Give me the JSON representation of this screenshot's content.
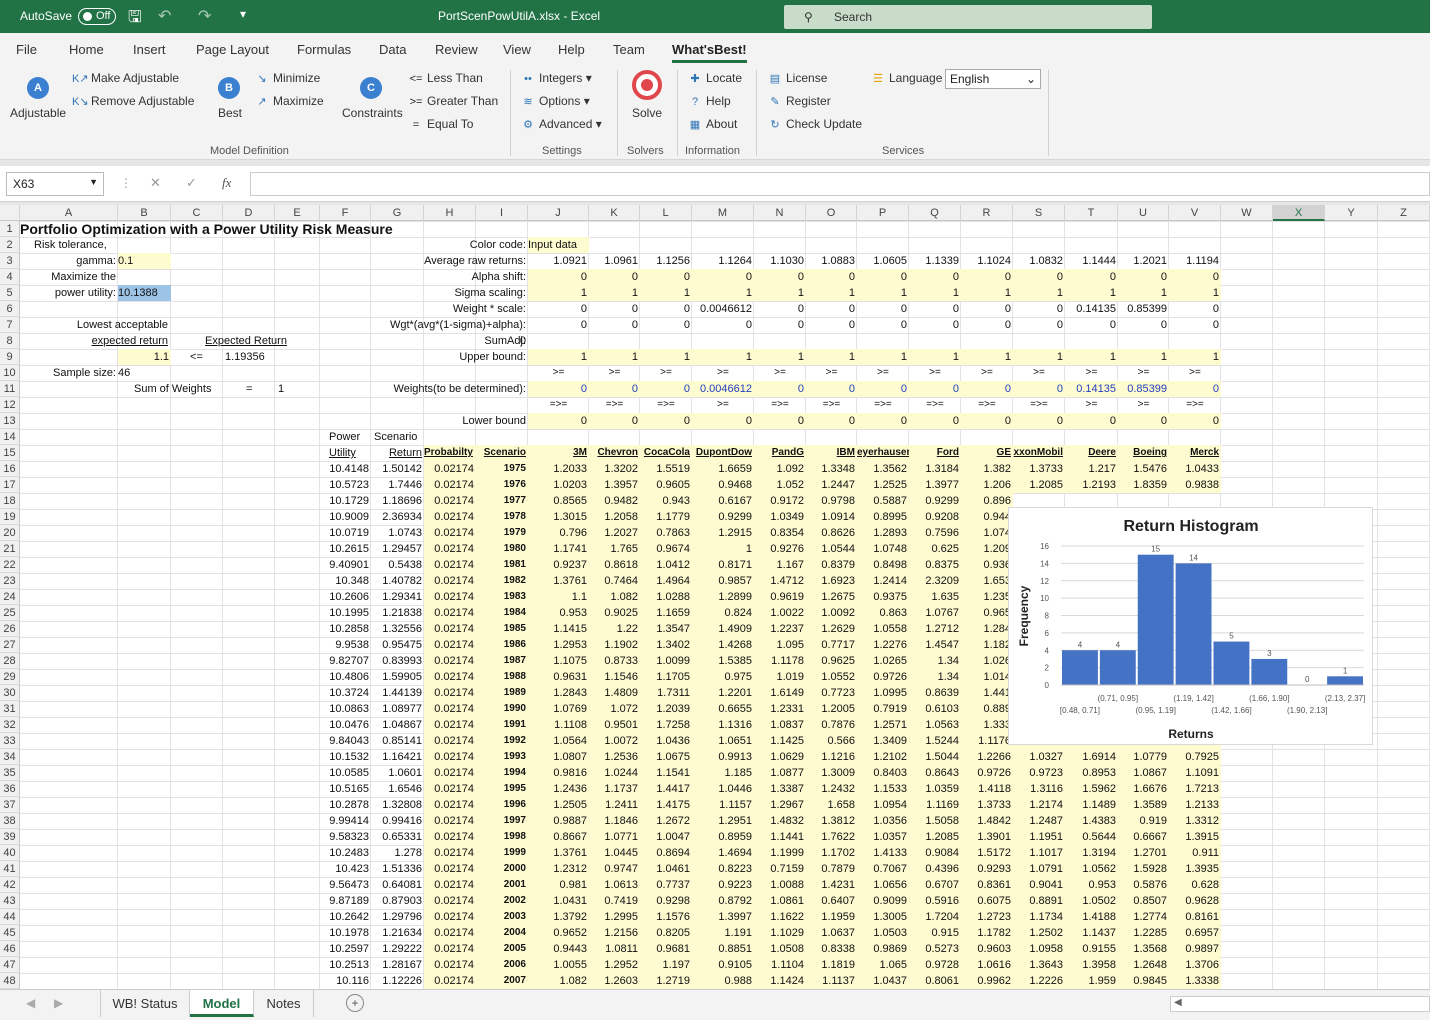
{
  "titlebar": {
    "autosave": "AutoSave",
    "toggle": "Off",
    "filename": "PortScenPowUtilA.xlsx  -  Excel",
    "search": "Search"
  },
  "tabs": [
    "File",
    "Home",
    "Insert",
    "Page Layout",
    "Formulas",
    "Data",
    "Review",
    "View",
    "Help",
    "Team",
    "What'sBest!"
  ],
  "ribbon": {
    "adjustable": "Adjustable",
    "make_adjustable": "Make Adjustable",
    "remove_adjustable": "Remove Adjustable",
    "best": "Best",
    "minimize": "Minimize",
    "maximize": "Maximize",
    "constraints": "Constraints",
    "less_than": "Less Than",
    "greater_than": "Greater Than",
    "equal_to": "Equal To",
    "integers": "Integers",
    "options": "Options",
    "advanced": "Advanced",
    "solve": "Solve",
    "locate": "Locate",
    "help": "Help",
    "about": "About",
    "license": "License",
    "register": "Register",
    "check_update": "Check Update",
    "language": "Language",
    "language_value": "English",
    "groups": {
      "model_definition": "Model Definition",
      "settings": "Settings",
      "solvers": "Solvers",
      "information": "Information",
      "services": "Services"
    }
  },
  "formula_bar": {
    "name_box": "X63",
    "cancel": "✕",
    "enter": "✓",
    "fx": "fx",
    "value": ""
  },
  "columns": [
    "A",
    "B",
    "C",
    "D",
    "E",
    "F",
    "G",
    "H",
    "I",
    "J",
    "K",
    "L",
    "M",
    "N",
    "O",
    "P",
    "Q",
    "R",
    "S",
    "T",
    "U",
    "V",
    "W",
    "X",
    "Y",
    "Z"
  ],
  "rows": [
    1,
    2,
    3,
    4,
    5,
    6,
    7,
    8,
    9,
    10,
    11,
    12,
    13,
    14,
    15,
    16,
    17,
    18,
    19,
    20,
    21,
    22,
    23,
    24,
    25,
    26,
    27,
    28,
    29,
    30,
    31,
    32,
    33,
    34,
    35,
    36,
    37,
    38,
    39,
    40,
    41,
    42,
    43,
    44,
    45,
    46,
    47,
    48
  ],
  "cells": {
    "title": "Portfolio Optimization with a Power Utility Risk Measure",
    "risk_tol": "Risk tolerance,",
    "gamma_lbl": "gamma:",
    "gamma": "0.1",
    "max_the": "Maximize the",
    "power_util_lbl": "power utility:",
    "power_util": "10.1388",
    "lowest": "Lowest acceptable",
    "exp_ret_lbl": "expected return",
    "exp_ret_hdr": "Expected Return",
    "min_ret": "1.1",
    "le": "<=",
    "exp_ret": "1.19356",
    "sample_lbl": "Sample size:",
    "sample": "46",
    "sum_w_lbl": "Sum of Weights",
    "eq": "=",
    "sum_w": "1",
    "color_code": "Color code:",
    "input_data": "Input data",
    "avg_raw": "Average raw returns:",
    "alpha": "Alpha shift:",
    "sigma": "Sigma scaling:",
    "wscale": "Weight * scale:",
    "wgt_expr": "Wgt*(avg*(1-sigma)+alpha):",
    "sumadj": "SumAdj:",
    "sumadj_v": "0",
    "upper": "Upper bound:",
    "weights_lbl": "Weights(to be determined):",
    "lower": "Lower bound",
    "power": "Power",
    "scenario": "Scenario",
    "utility": "Utility",
    "return": "Return",
    "probability": "Probabilty",
    "scen_hdr": "Scenario"
  },
  "assets": [
    "3M",
    "Chevron",
    "CocaCola",
    "DupontDow",
    "PandG",
    "IBM",
    "eyerhauser",
    "Ford",
    "GE",
    "xxonMobil",
    "Deere",
    "Boeing",
    "Merck"
  ],
  "avg_returns": [
    "1.0921",
    "1.0961",
    "1.1256",
    "1.1264",
    "1.1030",
    "1.0883",
    "1.0605",
    "1.1339",
    "1.1024",
    "1.0832",
    "1.1444",
    "1.2021",
    "1.1194"
  ],
  "alpha_row": [
    "0",
    "0",
    "0",
    "0",
    "0",
    "0",
    "0",
    "0",
    "0",
    "0",
    "0",
    "0",
    "0"
  ],
  "sigma_row": [
    "1",
    "1",
    "1",
    "1",
    "1",
    "1",
    "1",
    "1",
    "1",
    "1",
    "1",
    "1",
    "1"
  ],
  "wscale_row": [
    "0",
    "0",
    "0",
    "0.0046612",
    "0",
    "0",
    "0",
    "0",
    "0",
    "0",
    "0.14135",
    "0.85399",
    "0"
  ],
  "wgt_row": [
    "0",
    "0",
    "0",
    "0",
    "0",
    "0",
    "0",
    "0",
    "0",
    "0",
    "0",
    "0",
    "0"
  ],
  "upper_row": [
    "1",
    "1",
    "1",
    "1",
    "1",
    "1",
    "1",
    "1",
    "1",
    "1",
    "1",
    "1",
    "1"
  ],
  "ge_row": [
    ">=",
    ">=",
    ">=",
    ">=",
    ">=",
    ">=",
    ">=",
    ">=",
    ">=",
    ">=",
    ">=",
    ">=",
    ">="
  ],
  "weights_row": [
    "0",
    "0",
    "0",
    "0.0046612",
    "0",
    "0",
    "0",
    "0",
    "0",
    "0",
    "0.14135",
    "0.85399",
    "0"
  ],
  "geq_row": [
    "=>=",
    "=>=",
    "=>=",
    ">=",
    "=>=",
    "=>=",
    "=>=",
    "=>=",
    "=>=",
    "=>=",
    ">=",
    ">=",
    "=>="
  ],
  "lower_row": [
    "0",
    "0",
    "0",
    "0",
    "0",
    "0",
    "0",
    "0",
    "0",
    "0",
    "0",
    "0",
    "0"
  ],
  "data_rows": [
    [
      "10.4148",
      "1.50142",
      "0.02174",
      "1975",
      "1.2033",
      "1.3202",
      "1.5519",
      "1.6659",
      "1.092",
      "1.3348",
      "1.3562",
      "1.3184",
      "1.382",
      "1.3733",
      "1.217",
      "1.5476",
      "1.0433"
    ],
    [
      "10.5723",
      "1.7446",
      "0.02174",
      "1976",
      "1.0203",
      "1.3957",
      "0.9605",
      "0.9468",
      "1.052",
      "1.2447",
      "1.2525",
      "1.3977",
      "1.206",
      "1.2085",
      "1.2193",
      "1.8359",
      "0.9838"
    ],
    [
      "10.1729",
      "1.18696",
      "0.02174",
      "1977",
      "0.8565",
      "0.9482",
      "0.943",
      "0.6167",
      "0.9172",
      "0.9798",
      "0.5887",
      "0.9299",
      "0.896",
      "",
      "",
      "",
      ""
    ],
    [
      "10.9009",
      "2.36934",
      "0.02174",
      "1978",
      "1.3015",
      "1.2058",
      "1.1779",
      "0.9299",
      "1.0349",
      "1.0914",
      "0.8995",
      "0.9208",
      "0.944",
      "",
      "",
      "",
      ""
    ],
    [
      "10.0719",
      "1.0743",
      "0.02174",
      "1979",
      "0.796",
      "1.2027",
      "0.7863",
      "1.2915",
      "0.8354",
      "0.8626",
      "1.2893",
      "0.7596",
      "1.074",
      "",
      "",
      "",
      ""
    ],
    [
      "10.2615",
      "1.29457",
      "0.02174",
      "1980",
      "1.1741",
      "1.765",
      "0.9674",
      "1",
      "0.9276",
      "1.0544",
      "1.0748",
      "0.625",
      "1.209",
      "",
      "",
      "",
      ""
    ],
    [
      "9.40901",
      "0.5438",
      "0.02174",
      "1981",
      "0.9237",
      "0.8618",
      "1.0412",
      "0.8171",
      "1.167",
      "0.8379",
      "0.8498",
      "0.8375",
      "0.936",
      "",
      "",
      "",
      ""
    ],
    [
      "10.348",
      "1.40782",
      "0.02174",
      "1982",
      "1.3761",
      "0.7464",
      "1.4964",
      "0.9857",
      "1.4712",
      "1.6923",
      "1.2414",
      "2.3209",
      "1.653",
      "",
      "",
      "",
      ""
    ],
    [
      "10.2606",
      "1.29341",
      "0.02174",
      "1983",
      "1.1",
      "1.082",
      "1.0288",
      "1.2899",
      "0.9619",
      "1.2675",
      "0.9375",
      "1.635",
      "1.235",
      "",
      "",
      "",
      ""
    ],
    [
      "10.1995",
      "1.21838",
      "0.02174",
      "1984",
      "0.953",
      "0.9025",
      "1.1659",
      "0.824",
      "1.0022",
      "1.0092",
      "0.863",
      "1.0767",
      "0.965",
      "",
      "",
      "",
      ""
    ],
    [
      "10.2858",
      "1.32556",
      "0.02174",
      "1985",
      "1.1415",
      "1.22",
      "1.3547",
      "1.4909",
      "1.2237",
      "1.2629",
      "1.0558",
      "1.2712",
      "1.284",
      "",
      "",
      "",
      ""
    ],
    [
      "9.9538",
      "0.95475",
      "0.02174",
      "1986",
      "1.2953",
      "1.1902",
      "1.3402",
      "1.4268",
      "1.095",
      "0.7717",
      "1.2276",
      "1.4547",
      "1.182",
      "",
      "",
      "",
      ""
    ],
    [
      "9.82707",
      "0.83993",
      "0.02174",
      "1987",
      "1.1075",
      "0.8733",
      "1.0099",
      "1.5385",
      "1.1178",
      "0.9625",
      "1.0265",
      "1.34",
      "1.026",
      "",
      "",
      "",
      ""
    ],
    [
      "10.4806",
      "1.59905",
      "0.02174",
      "1988",
      "0.9631",
      "1.1546",
      "1.1705",
      "0.975",
      "1.019",
      "1.0552",
      "0.9726",
      "1.34",
      "1.014",
      "",
      "",
      "",
      ""
    ],
    [
      "10.3724",
      "1.44139",
      "0.02174",
      "1989",
      "1.2843",
      "1.4809",
      "1.7311",
      "1.2201",
      "1.6149",
      "0.7723",
      "1.0995",
      "0.8639",
      "1.441",
      "",
      "",
      "",
      ""
    ],
    [
      "10.0863",
      "1.08977",
      "0.02174",
      "1990",
      "1.0769",
      "1.072",
      "1.2039",
      "0.6655",
      "1.2331",
      "1.2005",
      "0.7919",
      "0.6103",
      "0.889",
      "",
      "",
      "",
      ""
    ],
    [
      "10.0476",
      "1.04867",
      "0.02174",
      "1991",
      "1.1108",
      "0.9501",
      "1.7258",
      "1.1316",
      "1.0837",
      "0.7876",
      "1.2571",
      "1.0563",
      "1.333",
      "",
      "",
      "",
      ""
    ],
    [
      "9.84043",
      "0.85141",
      "0.02174",
      "1992",
      "1.0564",
      "1.0072",
      "1.0436",
      "1.0651",
      "1.1425",
      "0.566",
      "1.3409",
      "1.5244",
      "1.1176",
      "1.0041",
      "0.9115",
      "0.8403",
      "0.7815"
    ],
    [
      "10.1532",
      "1.16421",
      "0.02174",
      "1993",
      "1.0807",
      "1.2536",
      "1.0675",
      "0.9913",
      "1.0629",
      "1.1216",
      "1.2102",
      "1.5044",
      "1.2266",
      "1.0327",
      "1.6914",
      "1.0779",
      "0.7925"
    ],
    [
      "10.0585",
      "1.0601",
      "0.02174",
      "1994",
      "0.9816",
      "1.0244",
      "1.1541",
      "1.185",
      "1.0877",
      "1.3009",
      "0.8403",
      "0.8643",
      "0.9726",
      "0.9723",
      "0.8953",
      "1.0867",
      "1.1091"
    ],
    [
      "10.5165",
      "1.6546",
      "0.02174",
      "1995",
      "1.2436",
      "1.1737",
      "1.4417",
      "1.0446",
      "1.3387",
      "1.2432",
      "1.1533",
      "1.0359",
      "1.4118",
      "1.3116",
      "1.5962",
      "1.6676",
      "1.7213"
    ],
    [
      "10.2878",
      "1.32808",
      "0.02174",
      "1996",
      "1.2505",
      "1.2411",
      "1.4175",
      "1.1157",
      "1.2967",
      "1.658",
      "1.0954",
      "1.1169",
      "1.3733",
      "1.2174",
      "1.1489",
      "1.3589",
      "1.2133"
    ],
    [
      "9.99414",
      "0.99416",
      "0.02174",
      "1997",
      "0.9887",
      "1.1846",
      "1.2672",
      "1.2951",
      "1.4832",
      "1.3812",
      "1.0356",
      "1.5058",
      "1.4842",
      "1.2487",
      "1.4383",
      "0.919",
      "1.3312"
    ],
    [
      "9.58323",
      "0.65331",
      "0.02174",
      "1998",
      "0.8667",
      "1.0771",
      "1.0047",
      "0.8959",
      "1.1441",
      "1.7622",
      "1.0357",
      "1.2085",
      "1.3901",
      "1.1951",
      "0.5644",
      "0.6667",
      "1.3915"
    ],
    [
      "10.2483",
      "1.278",
      "0.02174",
      "1999",
      "1.3761",
      "1.0445",
      "0.8694",
      "1.4694",
      "1.1999",
      "1.1702",
      "1.4133",
      "0.9084",
      "1.5172",
      "1.1017",
      "1.3194",
      "1.2701",
      "0.911"
    ],
    [
      "10.423",
      "1.51336",
      "0.02174",
      "2000",
      "1.2312",
      "0.9747",
      "1.0461",
      "0.8223",
      "0.7159",
      "0.7879",
      "0.7067",
      "0.4396",
      "0.9293",
      "1.0791",
      "1.0562",
      "1.5928",
      "1.3935"
    ],
    [
      "9.56473",
      "0.64081",
      "0.02174",
      "2001",
      "0.981",
      "1.0613",
      "0.7737",
      "0.9223",
      "1.0088",
      "1.4231",
      "1.0656",
      "0.6707",
      "0.8361",
      "0.9041",
      "0.953",
      "0.5876",
      "0.628"
    ],
    [
      "9.87189",
      "0.87903",
      "0.02174",
      "2002",
      "1.0431",
      "0.7419",
      "0.9298",
      "0.8792",
      "1.0861",
      "0.6407",
      "0.9099",
      "0.5916",
      "0.6075",
      "0.8891",
      "1.0502",
      "0.8507",
      "0.9628"
    ],
    [
      "10.2642",
      "1.29796",
      "0.02174",
      "2003",
      "1.3792",
      "1.2995",
      "1.1576",
      "1.3997",
      "1.1622",
      "1.1959",
      "1.3005",
      "1.7204",
      "1.2723",
      "1.1734",
      "1.4188",
      "1.2774",
      "0.8161"
    ],
    [
      "10.1978",
      "1.21634",
      "0.02174",
      "2004",
      "0.9652",
      "1.2156",
      "0.8205",
      "1.191",
      "1.1029",
      "1.0637",
      "1.0503",
      "0.915",
      "1.1782",
      "1.2502",
      "1.1437",
      "1.2285",
      "0.6957"
    ],
    [
      "10.2597",
      "1.29222",
      "0.02174",
      "2005",
      "0.9443",
      "1.0811",
      "0.9681",
      "0.8851",
      "1.0508",
      "0.8338",
      "0.9869",
      "0.5273",
      "0.9603",
      "1.0958",
      "0.9155",
      "1.3568",
      "0.9897"
    ],
    [
      "10.2513",
      "1.28167",
      "0.02174",
      "2006",
      "1.0055",
      "1.2952",
      "1.197",
      "0.9105",
      "1.1104",
      "1.1819",
      "1.065",
      "0.9728",
      "1.0616",
      "1.3643",
      "1.3958",
      "1.2648",
      "1.3706"
    ],
    [
      "10.116",
      "1.12226",
      "0.02174",
      "2007",
      "1.082",
      "1.2603",
      "1.2719",
      "0.988",
      "1.1424",
      "1.1137",
      "1.0437",
      "0.8061",
      "0.9962",
      "1.2226",
      "1.959",
      "0.9845",
      "1.3338"
    ]
  ],
  "chart_data": {
    "type": "bar",
    "title": "Return Histogram",
    "xlabel": "Returns",
    "ylabel": "Frequency",
    "categories": [
      "[0.48, 0.71]",
      "(0.71, 0.95]",
      "(0.95, 1.19]",
      "(1.19, 1.42]",
      "(1.42, 1.66]",
      "(1.66, 1.90]",
      "(1.90, 2.13]",
      "(2.13, 2.37]"
    ],
    "values": [
      4,
      4,
      15,
      14,
      5,
      3,
      0,
      1
    ],
    "ylim": [
      0,
      16
    ],
    "yticks": [
      "0",
      "2",
      "4",
      "6",
      "8",
      "10",
      "12",
      "14",
      "16"
    ],
    "grid": true,
    "bar_color": "#4472c4"
  },
  "sheet_tabs": [
    "WB! Status",
    "Model",
    "Notes"
  ],
  "colors": {
    "excel_green": "#217346",
    "input_yellow": "#fffbd0"
  }
}
